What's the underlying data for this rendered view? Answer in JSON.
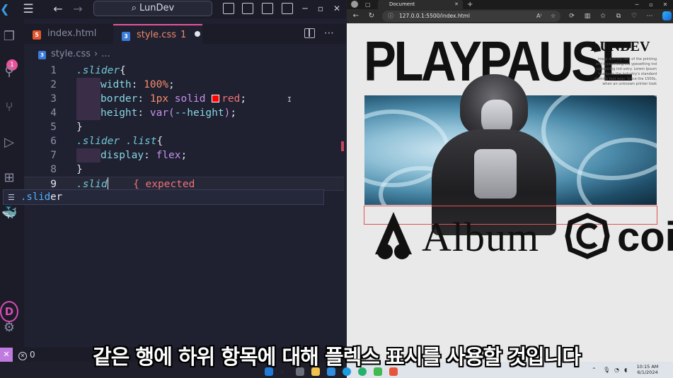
{
  "vscode": {
    "search_text": "LunDev",
    "tabs": [
      {
        "label": "index.html",
        "icon": "html5-icon"
      },
      {
        "label": "style.css",
        "icon": "css3-icon",
        "problems": "1"
      }
    ],
    "breadcrumb": {
      "file": "style.css",
      "rest": "..."
    },
    "activity_badge": "1",
    "avatar_letter": "D",
    "code": {
      "l1_sel": ".slider",
      "l1_brace": "{",
      "l2_prop": "width",
      "l2_val": "100%",
      "l3_prop": "border",
      "l3_num": "1px",
      "l3_kw": "solid",
      "l3_color": "red",
      "l4_prop": "height",
      "l4_fn": "var(",
      "l4_arg": "--height",
      "l4_close": ")",
      "l5": "}",
      "l6_sel": ".slider .list",
      "l6_brace": "{",
      "l7_prop": "display",
      "l7_val": "flex",
      "l8": "}",
      "l9_typed": ".slid",
      "l9_error": "{ expected"
    },
    "line_numbers": [
      "1",
      "2",
      "3",
      "4",
      "5",
      "6",
      "7",
      "8",
      "9"
    ],
    "suggestion": {
      "match": ".slid",
      "rest": "er"
    },
    "status_errors": "0"
  },
  "browser": {
    "tab_title": "Document",
    "url": "127.0.0.1:5500/index.html",
    "page": {
      "title": "PLAYPAUSE",
      "brand": "LUNDEV",
      "description": "imply dummy text of the printing and typesetting ind ypesetting ind ypesetting ind ustry. Lorem Ipsum has been the industry's standard dummy text ever. Since the 1500s, when an unknown printer took",
      "logo1": "Album",
      "logo2": "coi"
    }
  },
  "taskbar": {
    "time": "10:15 AM",
    "date": "6/1/2024"
  },
  "subtitle": "같은 행에 하위 항목에 대해 플렉스 표시를 사용할 것입니다"
}
